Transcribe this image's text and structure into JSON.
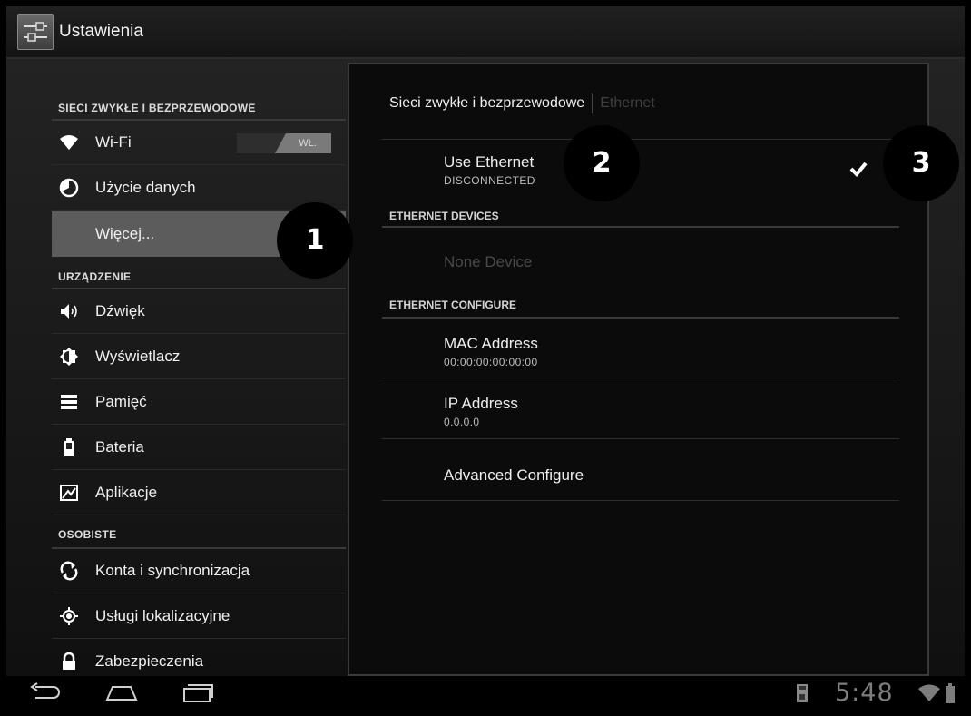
{
  "app": {
    "title": "Ustawienia",
    "icon": "settings-sliders-icon"
  },
  "sidebar": {
    "sections": [
      {
        "header": "SIECI ZWYKŁE I BEZPRZEWODOWE"
      },
      {
        "header": "URZĄDZENIE"
      },
      {
        "header": "OSOBISTE"
      }
    ],
    "items": [
      {
        "label": "Wi-Fi",
        "icon": "wifi-icon",
        "toggle": "WŁ."
      },
      {
        "label": "Użycie danych",
        "icon": "data-usage-icon"
      },
      {
        "label": "Więcej...",
        "selected": true
      },
      {
        "label": "Dźwięk",
        "icon": "speaker-icon"
      },
      {
        "label": "Wyświetlacz",
        "icon": "brightness-icon"
      },
      {
        "label": "Pamięć",
        "icon": "storage-icon"
      },
      {
        "label": "Bateria",
        "icon": "battery-icon"
      },
      {
        "label": "Aplikacje",
        "icon": "apps-icon"
      },
      {
        "label": "Konta i synchronizacja",
        "icon": "sync-icon"
      },
      {
        "label": "Usługi lokalizacyjne",
        "icon": "location-icon"
      },
      {
        "label": "Zabezpieczenia",
        "icon": "lock-icon"
      }
    ]
  },
  "main": {
    "breadcrumb": {
      "parent": "Sieci zwykłe i bezprzewodowe",
      "current": "Ethernet"
    },
    "use_ethernet": {
      "title": "Use Ethernet",
      "summary": "DISCONNECTED",
      "checked": true
    },
    "devices": {
      "header": "ETHERNET DEVICES",
      "none": "None Device"
    },
    "configure": {
      "header": "ETHERNET CONFIGURE",
      "mac": {
        "title": "MAC Address",
        "value": "00:00:00:00:00:00"
      },
      "ip": {
        "title": "IP Address",
        "value": "0.0.0.0"
      },
      "advanced": "Advanced Configure"
    }
  },
  "callouts": [
    "1",
    "2",
    "3"
  ],
  "statusbar": {
    "time": "5:48"
  },
  "colors": {
    "background": "#111111",
    "selected": "#5c5c5c",
    "text": "#f0f0f0"
  }
}
